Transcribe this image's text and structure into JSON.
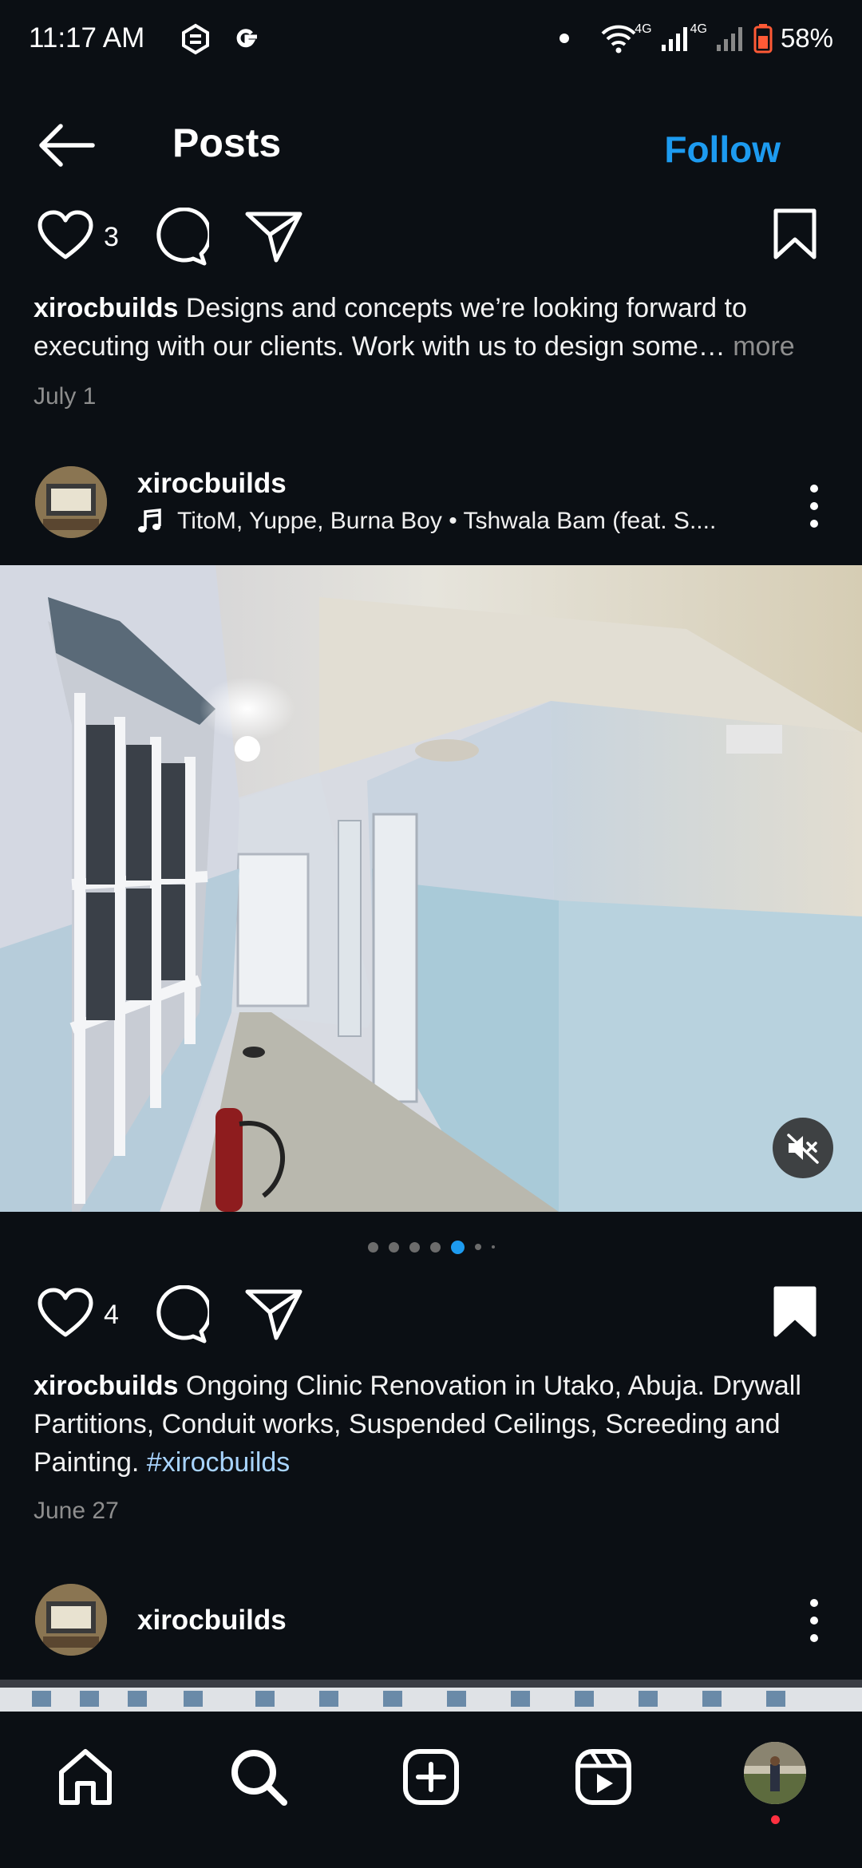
{
  "status_bar": {
    "time": "11:17 AM",
    "network_1": "4G",
    "network_2": "4G",
    "battery": "58%"
  },
  "header": {
    "title": "Posts",
    "follow_label": "Follow"
  },
  "post1": {
    "likes": "3",
    "username": "xirocbuilds",
    "caption": "Designs and concepts we’re looking forward to executing with our clients. Work with us to design some…",
    "more_label": "more",
    "date": "July 1"
  },
  "post2": {
    "username": "xirocbuilds",
    "music": "TitoM, Yuppe, Burna Boy • Tshwala Bam (feat. S....",
    "likes": "4",
    "caption_user": "xirocbuilds",
    "caption": "Ongoing Clinic Renovation in Utako, Abuja. Drywall Partitions, Conduit works, Suspended Ceilings, Screeding and Painting.",
    "hashtag": "#xirocbuilds",
    "date": "June 27",
    "carousel": {
      "total": 7,
      "active_index": 4
    }
  },
  "post3": {
    "username": "xirocbuilds"
  },
  "icons": {
    "back": "arrow-left-icon",
    "like": "heart-icon",
    "comment": "comment-bubble-icon",
    "share": "paper-plane-icon",
    "save": "bookmark-icon",
    "music": "music-note-icon",
    "more": "more-vertical-icon",
    "mute": "speaker-muted-icon",
    "home": "home-icon",
    "search": "search-icon",
    "create": "plus-square-icon",
    "reels": "reels-icon",
    "profile": "profile-avatar"
  },
  "colors": {
    "background": "#0b0f14",
    "accent": "#1d9bf0",
    "hashtag": "#a8d4ff",
    "secondary_text": "#8e8e8e",
    "notification": "#ff3040"
  }
}
